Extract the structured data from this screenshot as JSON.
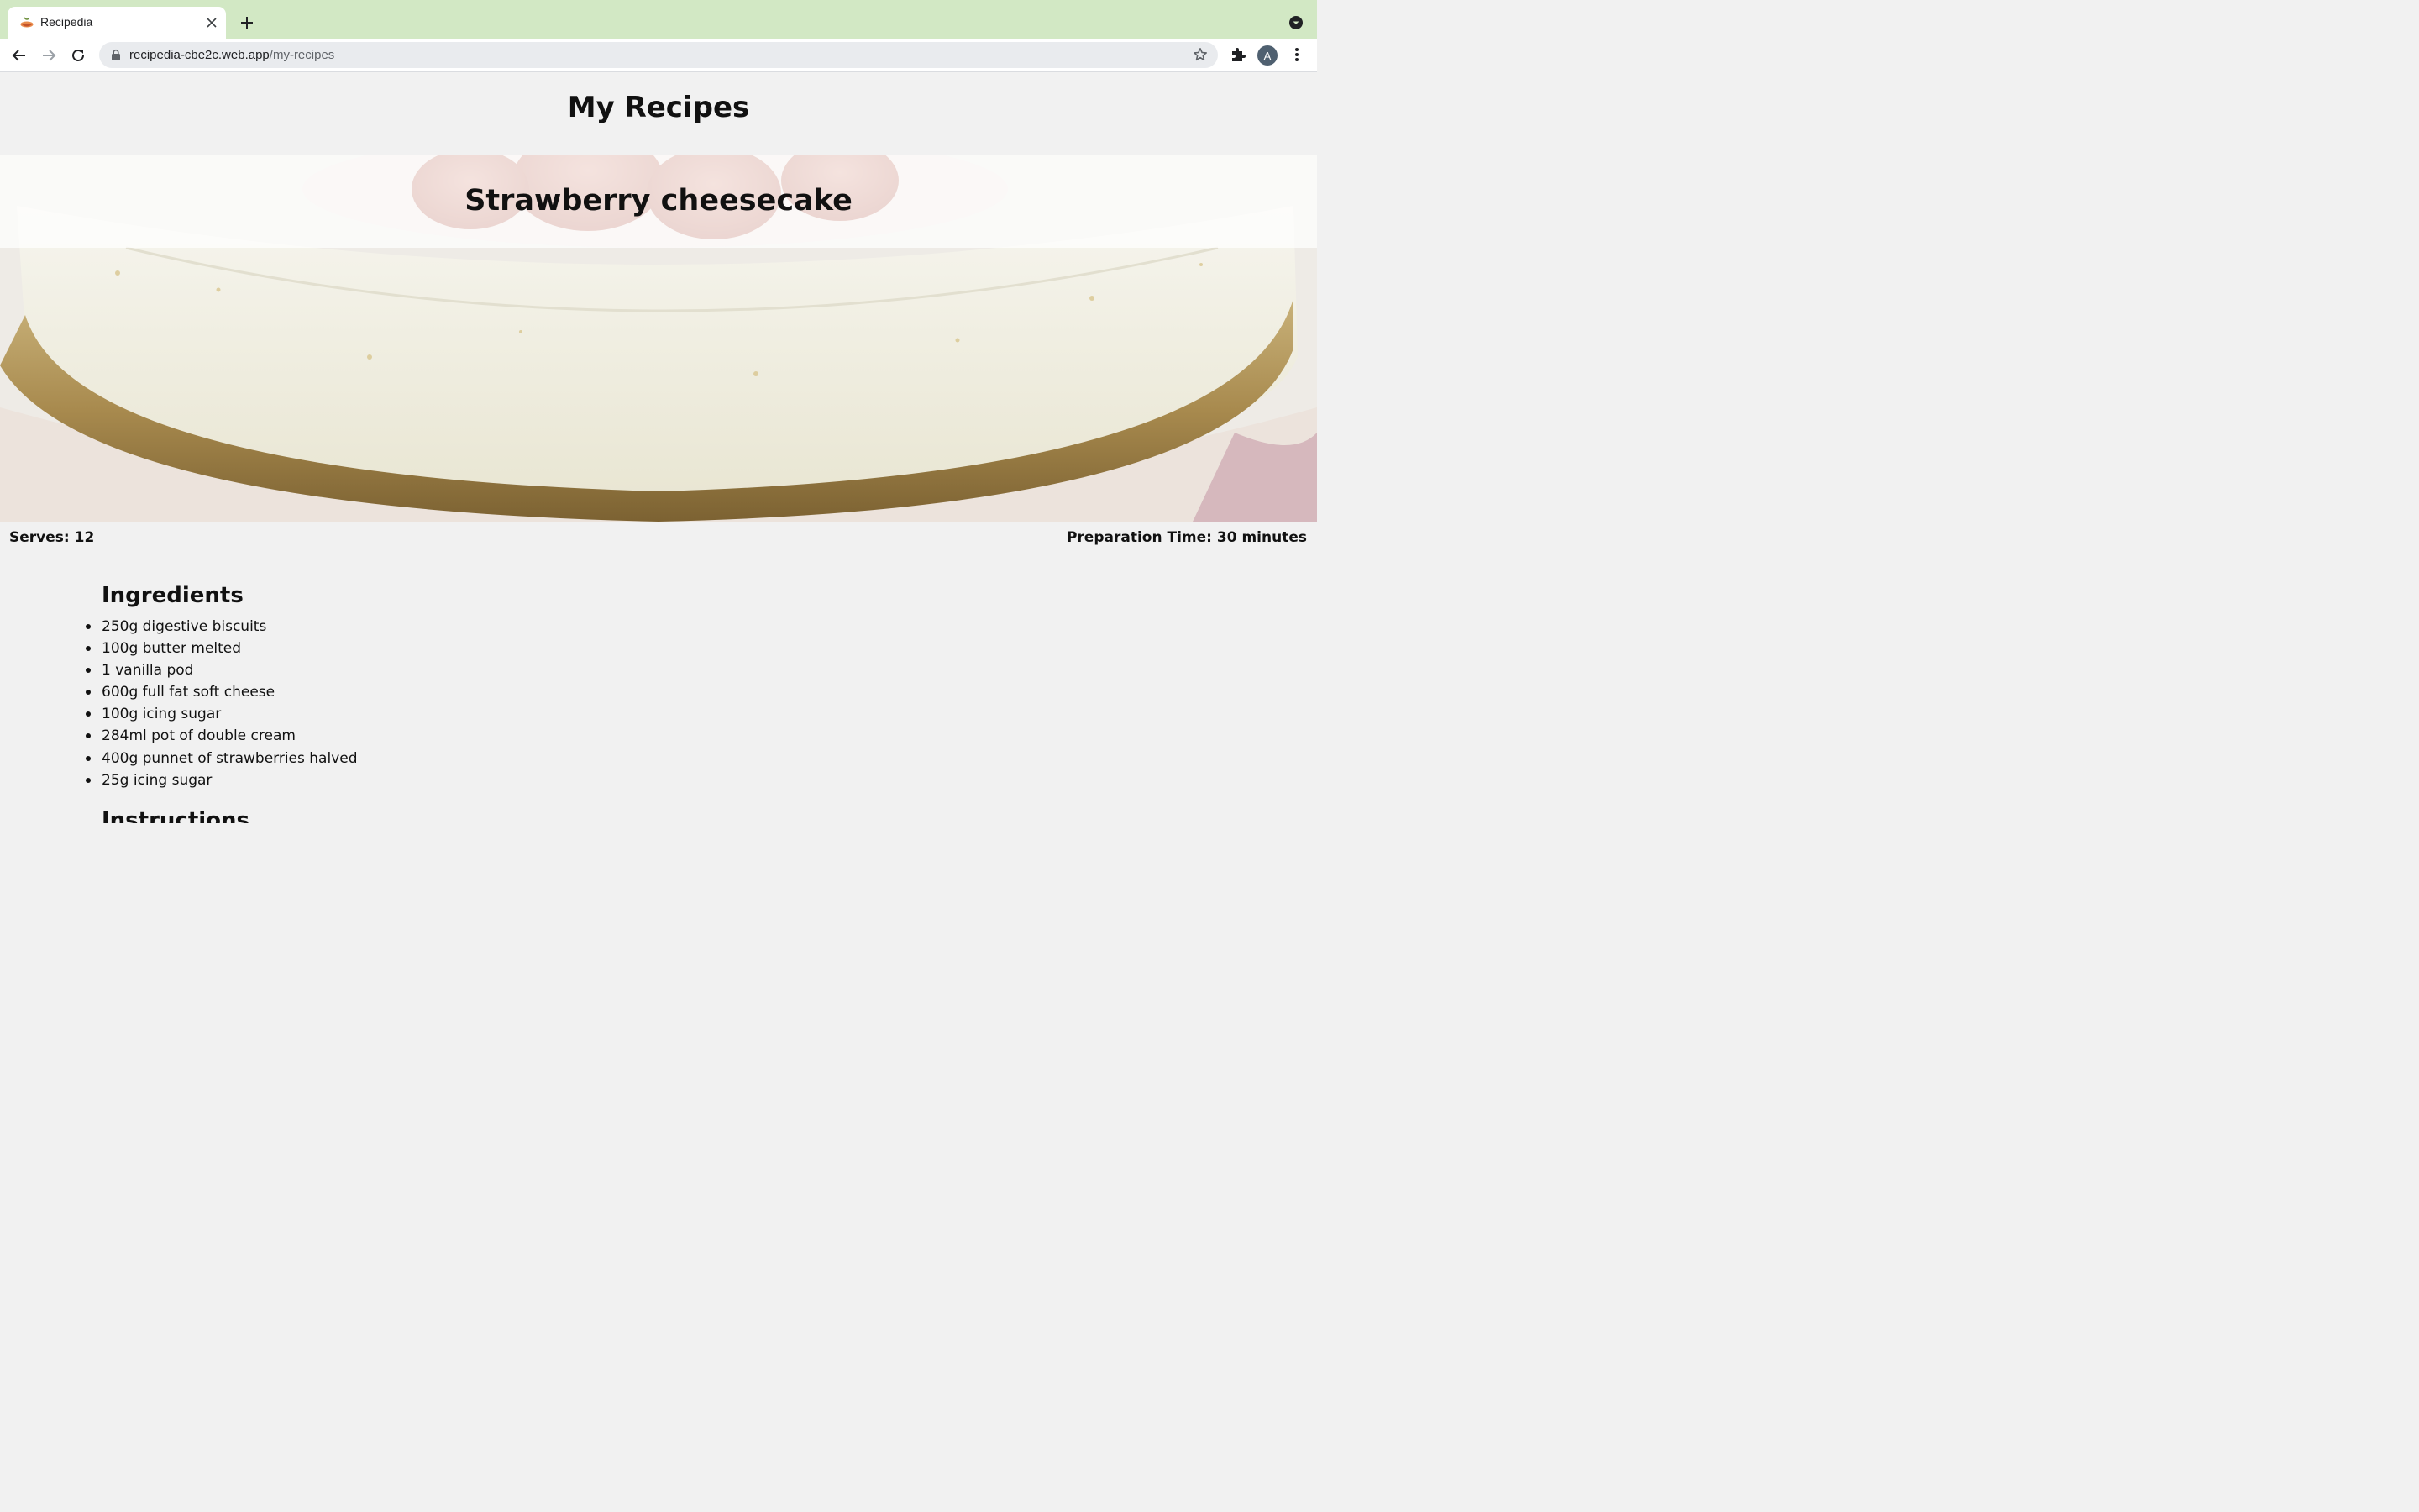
{
  "browser": {
    "tab_title": "Recipedia",
    "url_domain": "recipedia-cbe2c.web.app",
    "url_path": "/my-recipes",
    "profile_initial": "A",
    "tabstrip_color": "#d2e8c4"
  },
  "page": {
    "title": "My Recipes"
  },
  "recipe": {
    "title": "Strawberry cheesecake",
    "serves_label": "Serves:",
    "serves_value": "12",
    "prep_label": "Preparation Time:",
    "prep_value": "30 minutes",
    "ingredients_heading": "Ingredients",
    "ingredients": [
      "250g digestive biscuits",
      "100g butter melted",
      "1 vanilla pod",
      "600g full fat soft cheese",
      "100g icing sugar",
      "284ml pot of double cream",
      "400g punnet of strawberries halved",
      "25g icing sugar"
    ],
    "instructions_heading": "Instructions"
  }
}
